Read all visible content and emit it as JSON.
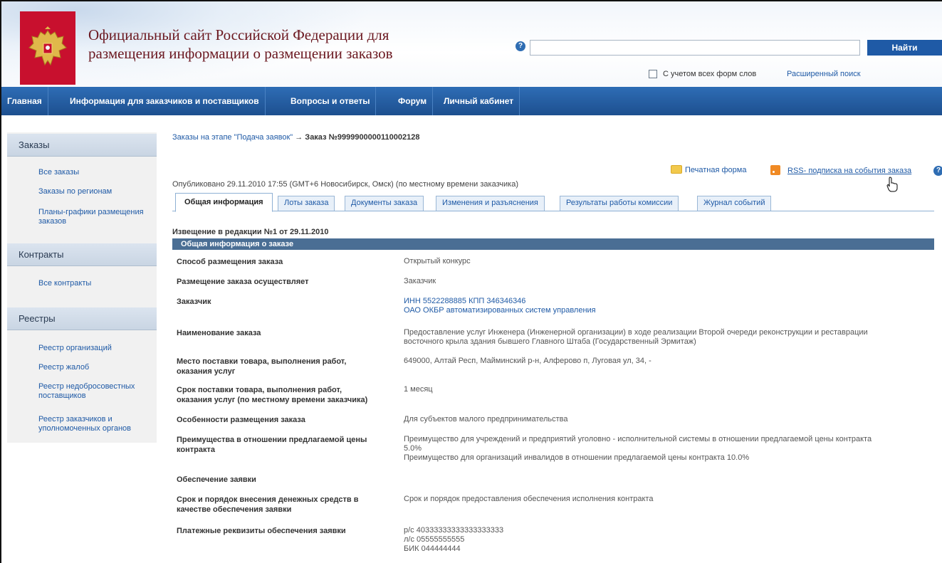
{
  "header": {
    "site_title_line1": "Официальный сайт Российской Федерации для",
    "site_title_line2": "размещения информации о размещении заказов",
    "help_glyph": "?",
    "search_placeholder": "",
    "search_button": "Найти",
    "wordforms_label": "С учетом всех форм слов",
    "advanced_search": "Расширенный поиск"
  },
  "nav": [
    "Главная",
    "Информация для заказчиков и поставщиков",
    "Вопросы и ответы",
    "Форум",
    "Личный кабинет"
  ],
  "sidebar": {
    "orders_header": "Заказы",
    "orders_links": [
      "Все заказы",
      "Заказы по регионам",
      "Планы-графики размещения заказов"
    ],
    "contracts_header": "Контракты",
    "contracts_links": [
      "Все контракты"
    ],
    "registries_header": "Реестры",
    "registries_links": [
      "Реестр организаций",
      "Реестр жалоб",
      "Реестр недобросовестных поставщиков",
      "Реестр заказчиков и уполномоченных органов"
    ]
  },
  "breadcrumb": {
    "link": "Заказы на этапе \"Подача заявок\"",
    "arrow": " → ",
    "current": "Заказ №9999900000110002128"
  },
  "actions": {
    "print_form": "Печатная форма",
    "rss": "RSS- подписка на события заказа"
  },
  "published": "Опубликовано 29.11.2010 17:55 (GMT+6 Новосибирск, Омск) (по местному времени заказчика)",
  "tabs": [
    "Общая информация",
    "Лоты заказа",
    "Документы заказа",
    "Изменения и разъяснения",
    "Результаты работы комиссии",
    "Журнал событий"
  ],
  "notice_title": "Извещение в редакции №1 от 29.11.2010",
  "section_title": "Общая информация о заказе",
  "rows": [
    {
      "label": "Способ размещения заказа",
      "value": "Открытый конкурс"
    },
    {
      "label": "Размещение заказа осуществляет",
      "value": "Заказчик"
    },
    {
      "label": "Заказчик",
      "value_line1": "ИНН 5522288885 КПП 346346346",
      "value_line2": "ОАО ОКБР автоматизированных систем управления"
    },
    {
      "label": "Наименование заказа",
      "value_line1": "Предоставление услуг Инженера (Инженерной организации) в ходе реализации Второй очереди реконструкции и реставрации",
      "value_line2": "восточного крыла здания бывшего Главного Штаба (Государственный Эрмитаж)"
    },
    {
      "label_line1": "Место поставки товара, выполнения работ,",
      "label_line2": "оказания услуг",
      "value": "649000, Алтай Респ, Майминский р-н, Алферово п, Луговая ул, 34, -"
    },
    {
      "label_line1": "Срок поставки товара, выполнения работ,",
      "label_line2": "оказания услуг (по местному времени заказчика)",
      "value": "1 месяц"
    },
    {
      "label": "Особенности размещения заказа",
      "value": "Для субъектов малого предпринимательства"
    },
    {
      "label_line1": "Преимущества в отношении предлагаемой цены",
      "label_line2": "контракта",
      "value_line1": "Преимущество для учреждений и предприятий уголовно - исполнительной системы в отношении предлагаемой цены контракта",
      "value_line2": "5.0%",
      "value_line3": "Преимущество для организаций инвалидов в отношении предлагаемой цены контракта 10.0%"
    },
    {
      "label": "Обеспечение заявки"
    },
    {
      "label_line1": "Срок и порядок внесения денежных средств в",
      "label_line2": "качестве обеспечения заявки",
      "value": "Срок и порядок предоставления обеспечения исполнения контракта"
    },
    {
      "label": "Платежные реквизиты обеспечения заявки",
      "value_line1": "р/с 40333333333333333333",
      "value_line2": "л/с 05555555555",
      "value_line3": "БИК 044444444"
    }
  ]
}
